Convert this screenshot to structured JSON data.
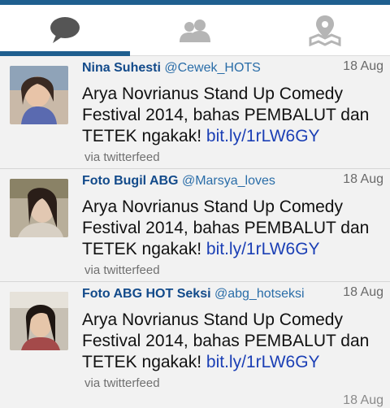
{
  "tabs": [
    {
      "id": "timeline",
      "icon": "speech-bubble-icon",
      "active": true
    },
    {
      "id": "people",
      "icon": "people-icon",
      "active": false
    },
    {
      "id": "places",
      "icon": "map-pin-icon",
      "active": false
    }
  ],
  "tweets": [
    {
      "name": "Nina Suhesti",
      "handle": "@Cewek_HOTS",
      "time": "18 Aug",
      "text": "Arya Novrianus Stand Up Comedy Festival 2014, bahas PEMBALUT dan TETEK ngakak! ",
      "link": "bit.ly/1rLW6GY",
      "via": "via twitterfeed"
    },
    {
      "name": "Foto Bugil ABG",
      "handle": "@Marsya_loves",
      "time": "18 Aug",
      "text": "Arya Novrianus Stand Up Comedy Festival 2014, bahas PEMBALUT dan TETEK ngakak! ",
      "link": "bit.ly/1rLW6GY",
      "via": "via twitterfeed"
    },
    {
      "name": "Foto ABG HOT Seksi",
      "handle": "@abg_hotseksi",
      "time": "18 Aug",
      "text": "Arya Novrianus Stand Up Comedy Festival 2014, bahas PEMBALUT dan TETEK ngakak! ",
      "link": "bit.ly/1rLW6GY",
      "via": "via twitterfeed"
    }
  ],
  "partial": {
    "time": "18 Aug"
  },
  "colors": {
    "accent": "#1f5f8f",
    "link": "#1b3fb5",
    "name": "#124a8a"
  }
}
